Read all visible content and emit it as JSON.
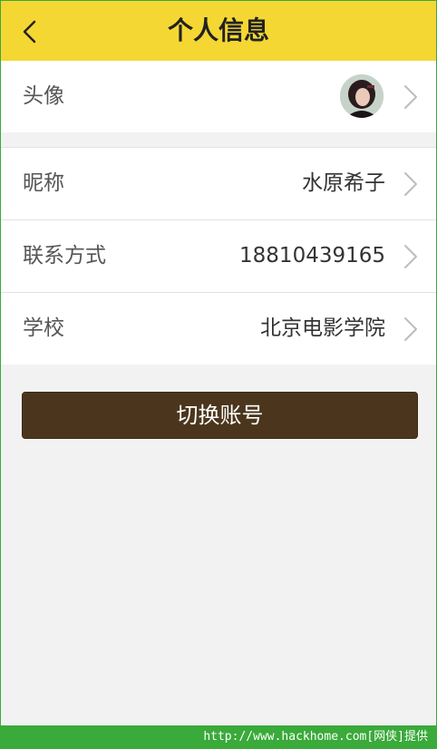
{
  "header": {
    "title": "个人信息"
  },
  "profile": {
    "avatar_label": "头像",
    "rows": [
      {
        "label": "昵称",
        "value": "水原希子"
      },
      {
        "label": "联系方式",
        "value": "18810439165"
      },
      {
        "label": "学校",
        "value": "北京电影学院"
      }
    ]
  },
  "actions": {
    "switch_account_label": "切换账号"
  },
  "watermark": {
    "text": "http://www.hackhome.com[网侠]提供"
  },
  "colors": {
    "header_bg": "#f5d733",
    "button_bg": "#4b361d",
    "page_bg": "#f2f2f2",
    "watermark_bg": "#3aaa3a"
  }
}
